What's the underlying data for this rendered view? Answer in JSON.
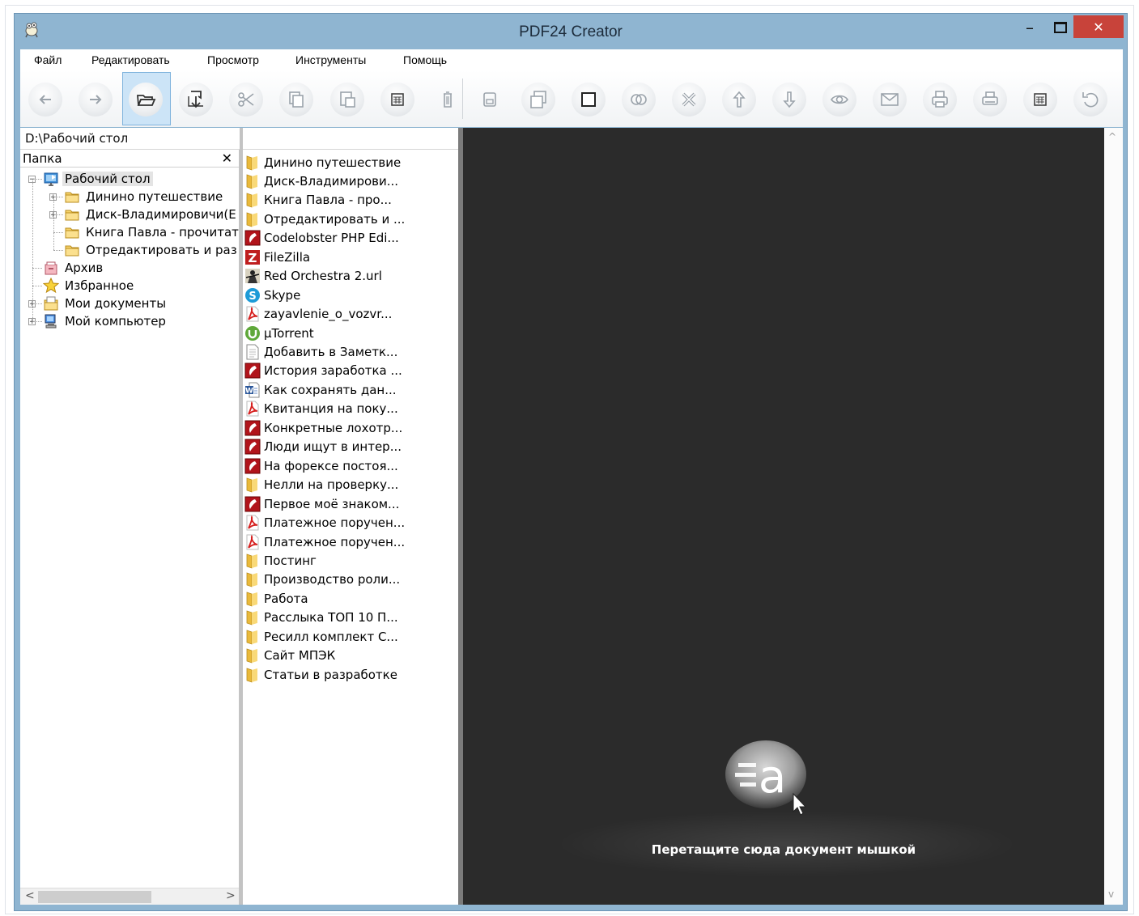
{
  "window": {
    "title": "PDF24 Creator",
    "minimize_glyph": "–",
    "close_glyph": "✕"
  },
  "menu": [
    "Файл",
    "Редактировать",
    "Просмотр",
    "Инструменты",
    "Помощь"
  ],
  "toolbar": {
    "buttons": [
      "back-icon",
      "forward-icon",
      "open-folder-icon",
      "import-icon",
      "cut-icon",
      "copy-icon",
      "paste-icon",
      "calculator-icon",
      "trash-icon",
      "save-icon",
      "save-as-icon",
      "new-page-icon",
      "merge-icon",
      "delete-icon",
      "move-up-icon",
      "move-down-icon",
      "preview-eye-icon",
      "email-icon",
      "print-icon",
      "printer-icon",
      "fax-icon",
      "undo-icon"
    ],
    "selected": "open-folder-icon"
  },
  "path": "D:\\Рабочий стол",
  "tree": {
    "header": "Папка",
    "close": "✕",
    "nodes": [
      {
        "label": "Рабочий стол",
        "icon": "desktop-icon",
        "level": 0,
        "expander": "−",
        "selected": true
      },
      {
        "label": "Динино путешествие",
        "icon": "folder-icon",
        "level": 1,
        "expander": "+"
      },
      {
        "label": "Диск-Владимировичи(Е",
        "icon": "folder-icon",
        "level": 1,
        "expander": "+"
      },
      {
        "label": "Книга Павла  - прочитать",
        "icon": "folder-icon",
        "level": 1,
        "expander": ""
      },
      {
        "label": "Отредактировать и раз",
        "icon": "folder-icon",
        "level": 1,
        "expander": ""
      },
      {
        "label": "Архив",
        "icon": "archive-icon",
        "level": 0,
        "expander": ""
      },
      {
        "label": "Избранное",
        "icon": "star-icon",
        "level": 0,
        "expander": ""
      },
      {
        "label": "Мои документы",
        "icon": "documents-icon",
        "level": 0,
        "expander": "+"
      },
      {
        "label": "Мой компьютер",
        "icon": "computer-icon",
        "level": 0,
        "expander": "+"
      }
    ],
    "scroll_left": "<",
    "scroll_right": ">"
  },
  "files": [
    {
      "label": "Динино путешествие",
      "icon": "folder-icon"
    },
    {
      "label": "Диск-Владимирови...",
      "icon": "folder-icon"
    },
    {
      "label": "Книга Павла  - про...",
      "icon": "folder-icon"
    },
    {
      "label": "Отредактировать и ...",
      "icon": "folder-icon"
    },
    {
      "label": "Codelobster PHP Edi...",
      "icon": "codelobster-icon"
    },
    {
      "label": "FileZilla",
      "icon": "filezilla-icon"
    },
    {
      "label": "Red Orchestra 2.url",
      "icon": "red-orchestra-icon"
    },
    {
      "label": "Skype",
      "icon": "skype-icon"
    },
    {
      "label": "zayavlenie_o_vozvr...",
      "icon": "pdf-icon"
    },
    {
      "label": "µTorrent",
      "icon": "utorrent-icon"
    },
    {
      "label": "Добавить в  Заметк...",
      "icon": "text-file-icon"
    },
    {
      "label": "История заработка ...",
      "icon": "codelobster-icon"
    },
    {
      "label": "Как сохранять дан...",
      "icon": "word-icon"
    },
    {
      "label": "Квитанция на поку...",
      "icon": "pdf-icon"
    },
    {
      "label": "Конкретные лохотр...",
      "icon": "codelobster-icon"
    },
    {
      "label": "Люди ищут в интер...",
      "icon": "codelobster-icon"
    },
    {
      "label": "На форексе постоя...",
      "icon": "codelobster-icon"
    },
    {
      "label": "Нелли на проверку...",
      "icon": "folder-icon"
    },
    {
      "label": "Первое моё знаком...",
      "icon": "codelobster-icon"
    },
    {
      "label": "Платежное поручен...",
      "icon": "pdf-icon"
    },
    {
      "label": "Платежное поручен...",
      "icon": "pdf-icon"
    },
    {
      "label": "Постинг",
      "icon": "folder-icon"
    },
    {
      "label": "Производство роли...",
      "icon": "folder-icon"
    },
    {
      "label": "Работа",
      "icon": "folder-icon"
    },
    {
      "label": "Расслыка ТОП 10 П...",
      "icon": "folder-icon"
    },
    {
      "label": "Ресилл комплект С...",
      "icon": "folder-icon"
    },
    {
      "label": "Сайт МПЭК",
      "icon": "folder-icon"
    },
    {
      "label": "Статьи в разработке",
      "icon": "folder-icon"
    }
  ],
  "preview": {
    "drop_hint": "Перетащите сюда документ мышкой",
    "scroll_up": "^",
    "scroll_down": "v"
  }
}
